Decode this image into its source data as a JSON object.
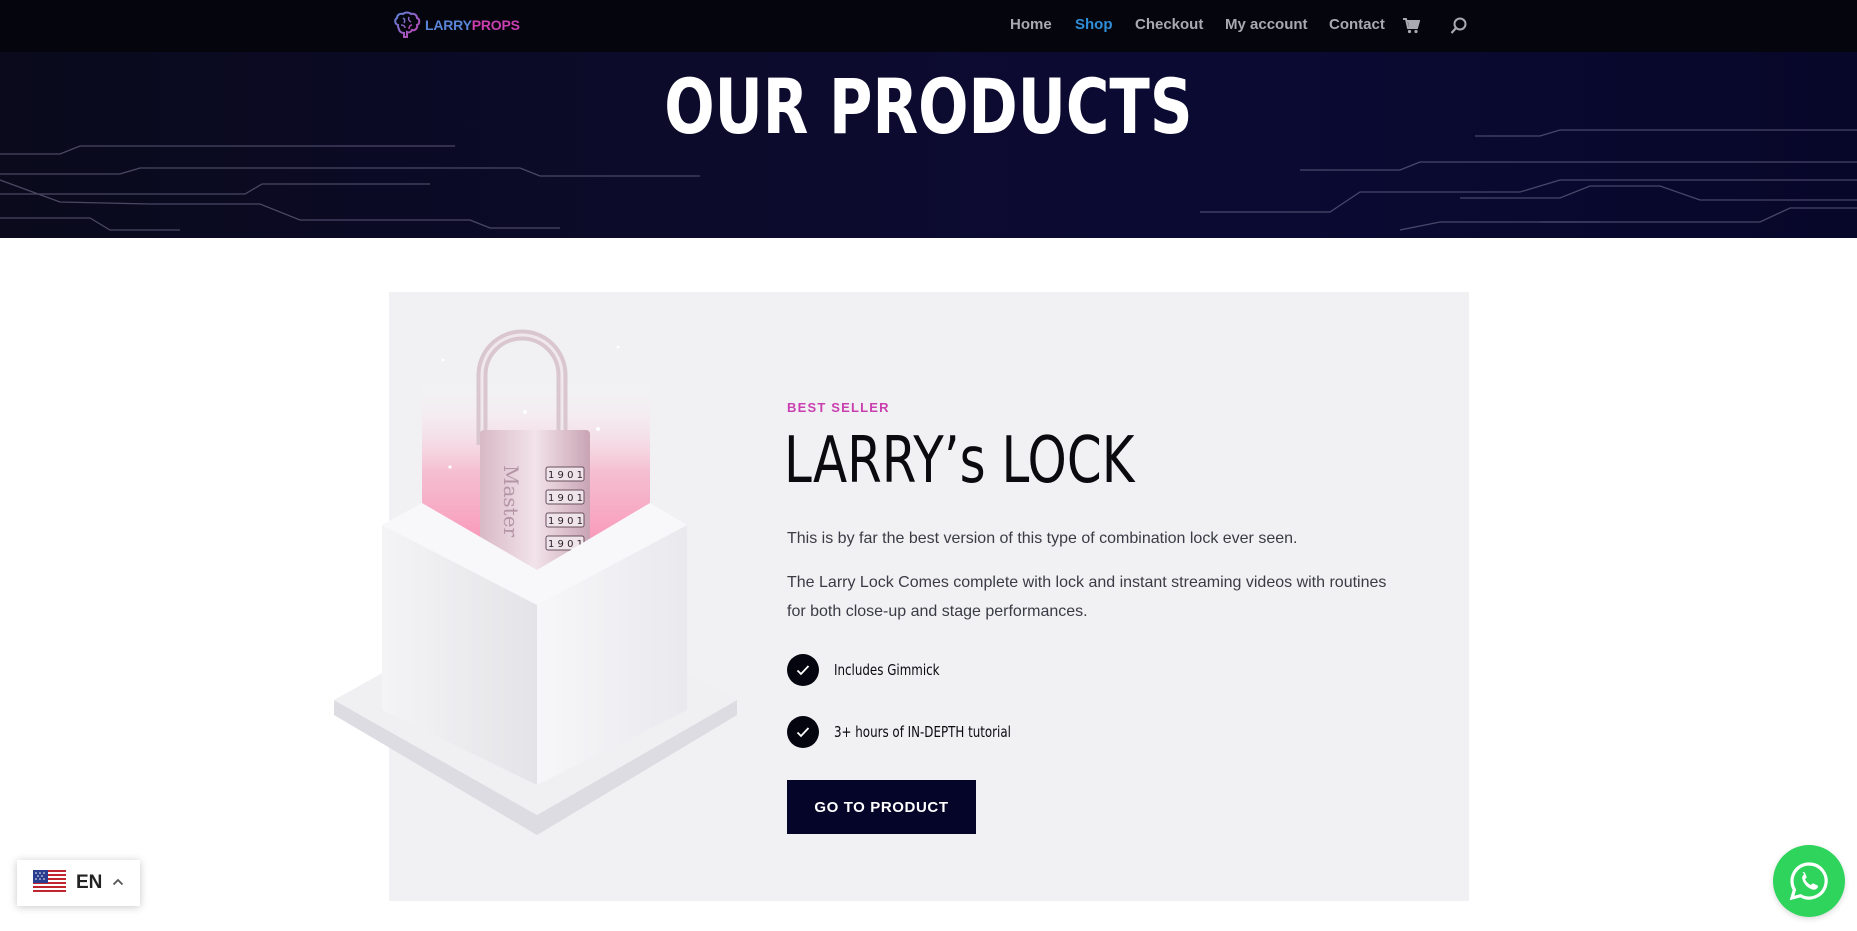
{
  "header": {
    "logo": {
      "part1": "LARRY",
      "part2": "PROPS",
      "icon": "brain-icon"
    },
    "nav": [
      {
        "label": "Home",
        "active": false
      },
      {
        "label": "Shop",
        "active": true
      },
      {
        "label": "Checkout",
        "active": false
      },
      {
        "label": "My account",
        "active": false
      },
      {
        "label": "Contact",
        "active": false
      }
    ],
    "cart_icon": "cart-icon",
    "search_icon": "search-icon"
  },
  "hero": {
    "title": "OUR PRODUCTS"
  },
  "product": {
    "badge": "BEST SELLER",
    "title": "LARRY’s LOCK",
    "description": [
      "This is by far the best version of this type of combination lock ever seen.",
      "The Larry Lock Comes complete with lock and instant streaming videos with routines for both close-up and stage performances."
    ],
    "features": [
      "Includes Gimmick",
      "3+ hours of IN-DEPTH tutorial"
    ],
    "cta_label": "GO TO PRODUCT",
    "image_icon": "padlock-in-box-illustration"
  },
  "language_switcher": {
    "code": "EN",
    "flag_icon": "us-flag-icon",
    "chevron_icon": "chevron-up-icon"
  },
  "whatsapp": {
    "icon": "whatsapp-icon"
  },
  "colors": {
    "nav_bg": "#05050d",
    "nav_active": "#2f8ed8",
    "accent_pink": "#c93fb0",
    "cta_bg": "#05052a",
    "card_bg": "#f1f1f3",
    "whatsapp": "#2fd45c"
  }
}
